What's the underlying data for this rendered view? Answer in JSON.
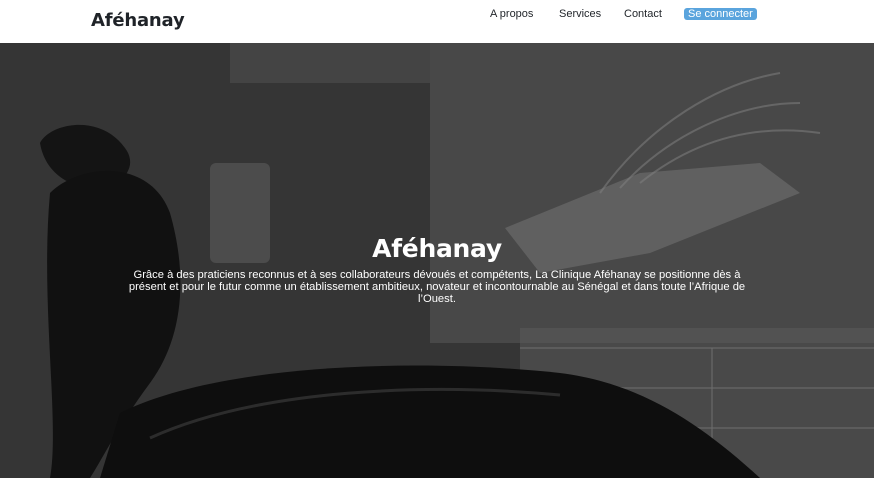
{
  "header": {
    "brand": "Aféhanay",
    "nav": {
      "about": "A propos",
      "services": "Services",
      "contact": "Contact",
      "login": "Se connecter"
    },
    "colors": {
      "login_bg": "#5aa4dd",
      "text": "#1f2328"
    }
  },
  "hero": {
    "title": "Aféhanay",
    "text": "Grâce à des praticiens reconnus et à ses collaborateurs dévoués et compétents, La Clinique Aféhanay se positionne dès à présent et pour le futur comme un établissement ambitieux, novateur et incontournable au Sénégal et dans toute l’Afrique de l’Ouest.",
    "background_image": "dental-chair-photo"
  }
}
